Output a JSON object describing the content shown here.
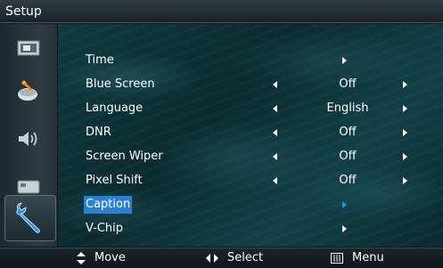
{
  "window": {
    "title": "Setup"
  },
  "sidebar": {
    "icons": [
      {
        "name": "picture-icon"
      },
      {
        "name": "sound-dish-icon"
      },
      {
        "name": "speaker-icon"
      },
      {
        "name": "card-icon"
      },
      {
        "name": "wrench-icon",
        "active": true
      }
    ]
  },
  "menu": {
    "items": [
      {
        "label": "Time",
        "type": "submenu"
      },
      {
        "label": "Blue Screen",
        "type": "option",
        "value": "Off"
      },
      {
        "label": "Language",
        "type": "option",
        "value": "English"
      },
      {
        "label": "DNR",
        "type": "option",
        "value": "Off"
      },
      {
        "label": "Screen Wiper",
        "type": "option",
        "value": "Off"
      },
      {
        "label": "Pixel Shift",
        "type": "option",
        "value": "Off"
      },
      {
        "label": "Caption",
        "type": "submenu",
        "selected": true
      },
      {
        "label": "V-Chip",
        "type": "submenu"
      }
    ]
  },
  "footer": {
    "move_label": "Move",
    "select_label": "Select",
    "menu_label": "Menu"
  },
  "colors": {
    "highlight": "#2a7fd6",
    "text": "#ffffff"
  }
}
